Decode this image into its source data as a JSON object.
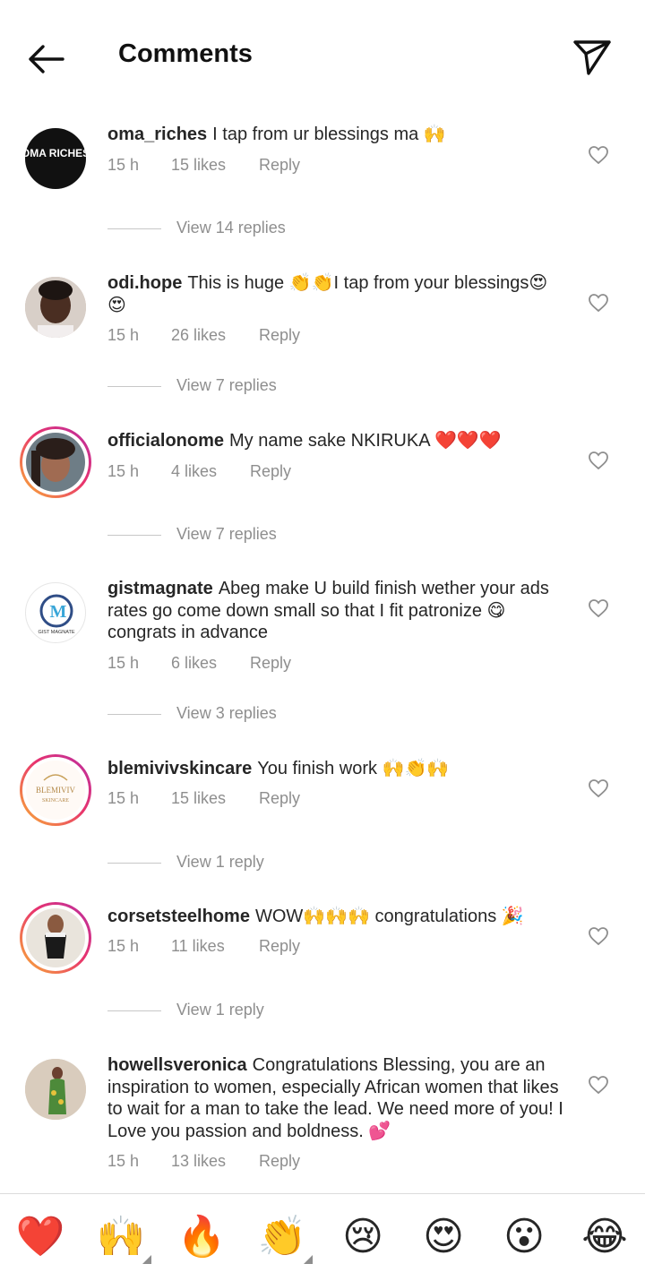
{
  "header": {
    "title": "Comments"
  },
  "comments": [
    {
      "user": "oma_riches",
      "text": "I tap from ur blessings ma 🙌",
      "time": "15 h",
      "likes": "15 likes",
      "reply": "Reply",
      "view": "View 14 replies",
      "avatar_text": "OMA RICHES"
    },
    {
      "user": "odi.hope",
      "text": "This is huge 👏👏I tap from your blessings😍😍",
      "time": "15 h",
      "likes": "26 likes",
      "reply": "Reply",
      "view": "View 7 replies"
    },
    {
      "user": "officialonome",
      "text": "My name sake NKIRUKA ❤️❤️❤️",
      "time": "15 h",
      "likes": "4 likes",
      "reply": "Reply",
      "view": "View 7 replies"
    },
    {
      "user": "gistmagnate",
      "text": "Abeg make U build finish wether your ads rates go come down small so that I fit patronize 😋 congrats in advance",
      "time": "15 h",
      "likes": "6 likes",
      "reply": "Reply",
      "view": "View 3 replies",
      "avatar_text": "GIST MAGNATE"
    },
    {
      "user": "blemivivskincare",
      "text": "You finish work 🙌👏🙌",
      "time": "15 h",
      "likes": "15 likes",
      "reply": "Reply",
      "view": "View 1 reply",
      "avatar_text": "BLEMIVIV",
      "avatar_sub": "SKINCARE"
    },
    {
      "user": "corsetsteelhome",
      "text": "WOW🙌🙌🙌 congratulations 🎉",
      "time": "15 h",
      "likes": "11 likes",
      "reply": "Reply",
      "view": "View 1 reply"
    },
    {
      "user": "howellsveronica",
      "text": "Congratulations Blessing, you are an inspiration to women, especially African women that likes to wait for a man to take the lead. We need more of you! I Love you passion and boldness. 💕",
      "time": "15 h",
      "likes": "13 likes",
      "reply": "Reply"
    }
  ],
  "reactions": [
    "❤️",
    "🙌",
    "🔥",
    "👏",
    "😢",
    "😍",
    "😮",
    "😂"
  ],
  "colors": {
    "ring_start": "#f9b234",
    "ring_mid": "#e8336d",
    "ring_end": "#b92fa3",
    "muted": "#8e8e8e"
  }
}
